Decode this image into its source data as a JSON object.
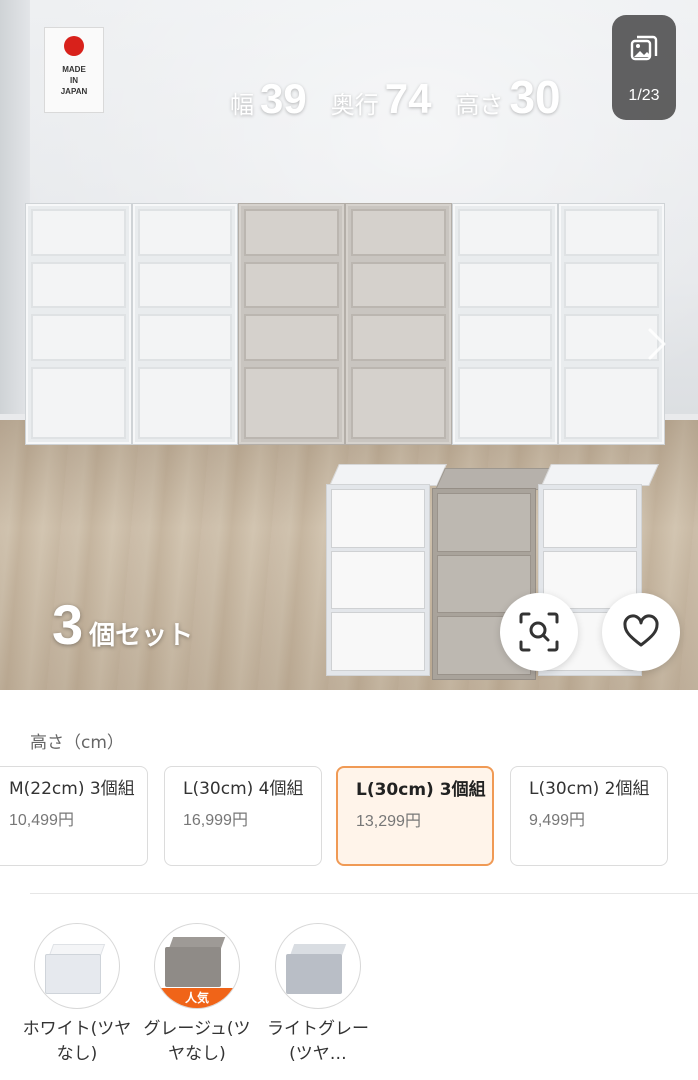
{
  "hero": {
    "made_in": [
      "MADE",
      "IN",
      "JAPAN"
    ],
    "dimensions": [
      {
        "label": "幅",
        "value": "39"
      },
      {
        "label": "奥行",
        "value": "74"
      },
      {
        "label": "高さ",
        "value": "30"
      }
    ],
    "gallery_counter": "1/23",
    "set_label_number": "3",
    "set_label_text": "個セット",
    "icons": {
      "gallery": "image-gallery-icon",
      "next": "chevron-right-icon",
      "visual_search": "visual-search-icon",
      "favorite": "heart-icon"
    }
  },
  "options": {
    "height_label": "高さ（cm）",
    "variants": [
      {
        "name": "M(22cm) 3個組",
        "price": "10,499円",
        "selected": false
      },
      {
        "name": "L(30cm) 4個組",
        "price": "16,999円",
        "selected": false
      },
      {
        "name": "L(30cm) 3個組",
        "price": "13,299円",
        "selected": true
      },
      {
        "name": "L(30cm) 2個組",
        "price": "9,499円",
        "selected": false
      }
    ],
    "colors": [
      {
        "label": "ホワイト(ツヤなし)",
        "badge": "",
        "top": "#f4f5f7",
        "front": "#e6e9ee"
      },
      {
        "label": "グレージュ(ツヤなし)",
        "badge": "人気",
        "top": "#9e9a96",
        "front": "#8f8b87"
      },
      {
        "label": "ライトグレー(ツヤ…",
        "badge": "",
        "top": "#d9dde2",
        "front": "#b9bec6"
      }
    ]
  },
  "colors_ui": {
    "accent": "#f09a55",
    "selected_bg": "#fff4ea",
    "popular_badge": "#f06418"
  }
}
